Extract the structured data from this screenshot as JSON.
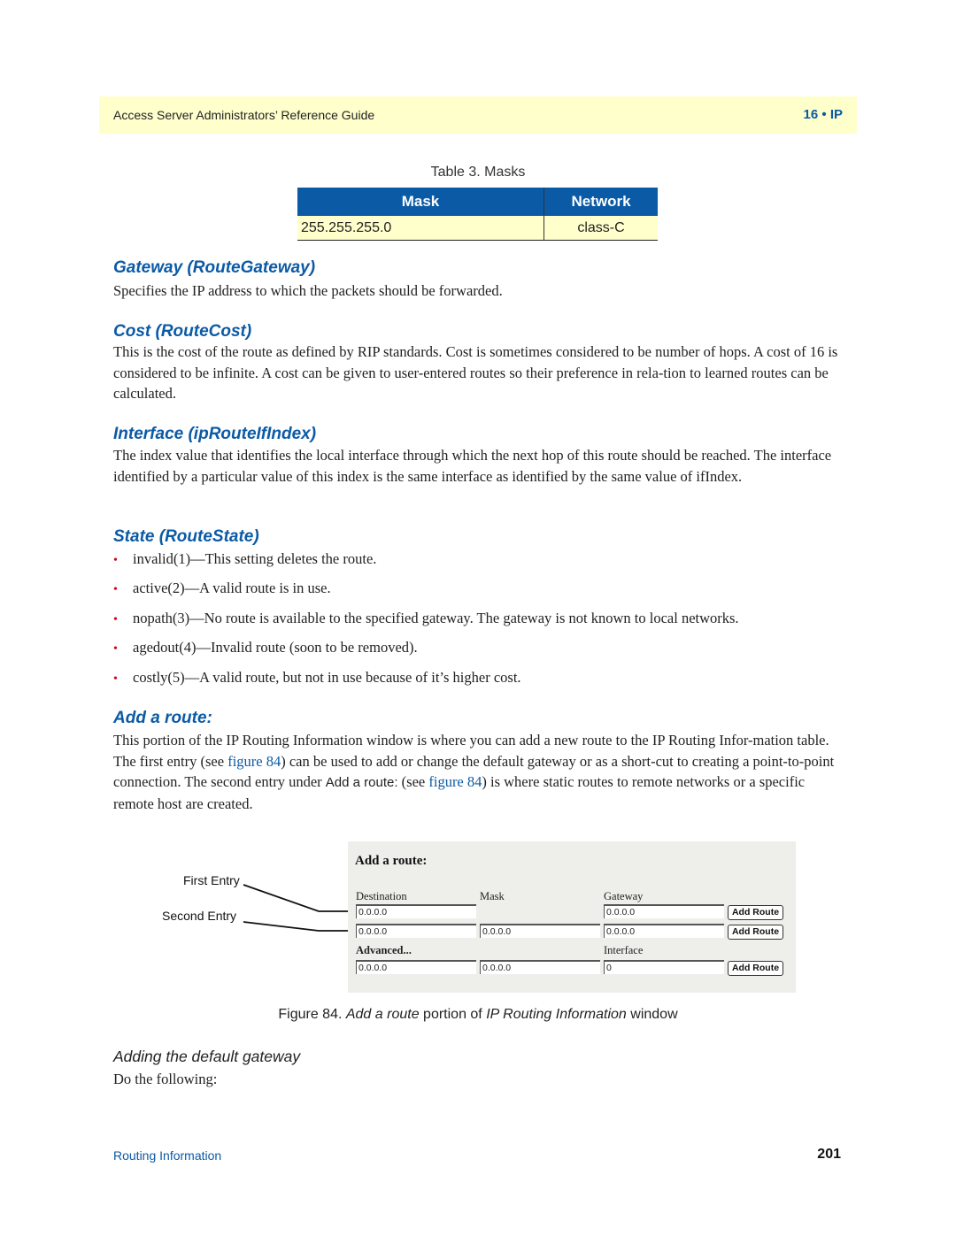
{
  "header": {
    "title": "Access Server Administrators’ Reference Guide",
    "chapter": "16 • IP"
  },
  "table": {
    "caption": "Table 3. Masks",
    "columns": [
      "Mask",
      "Network"
    ],
    "rows": [
      [
        "255.255.255.0",
        "class-C"
      ]
    ]
  },
  "sections": {
    "gateway": {
      "heading": "Gateway (RouteGateway)",
      "body": "Specifies the IP address to which the packets should be forwarded."
    },
    "cost": {
      "heading": "Cost (RouteCost)",
      "body": "This is the cost of the route as defined by RIP standards. Cost is sometimes considered to be number of hops. A cost of 16 is considered to be infinite. A cost can be given to user-entered routes so their preference in rela-tion to learned routes can be calculated."
    },
    "interface": {
      "heading": "Interface (ipRouteIfIndex)",
      "body": "The index value that identifies the local interface through which the next hop of this route should be reached. The interface identified by a particular value of this index is the same interface as identified by the same value of ifIndex."
    },
    "state": {
      "heading": "State (RouteState)",
      "bullets": [
        "invalid(1)—This setting deletes the route.",
        "active(2)—A valid route is in use.",
        "nopath(3)—No route is available to the specified gateway. The gateway is not known to local networks.",
        "agedout(4)—Invalid route (soon to be removed).",
        "costly(5)—A valid route, but not in use because of it’s higher cost."
      ]
    },
    "add_route": {
      "heading": "Add a route:",
      "body_1": "This portion of the IP Routing Information window is where you can add a new route to the IP Routing Infor-mation table. The first entry (see ",
      "link_1": "figure 84",
      "body_2": ") can be used to add or change the default gateway or as a short-cut to creating a point-to-point connection. The second entry under ",
      "inline_ui": "Add a route:",
      "body_3": " (see ",
      "link_2": "figure 84",
      "body_4": ") is where static routes to remote networks or a specific remote host are created."
    }
  },
  "figure": {
    "title": "Add a route:",
    "callouts": [
      "First Entry",
      "Second Entry"
    ],
    "labels": {
      "destination": "Destination",
      "mask": "Mask",
      "gateway": "Gateway",
      "advanced": "Advanced...",
      "interface": "Interface"
    },
    "row1": {
      "destination": "0.0.0.0",
      "gateway": "0.0.0.0",
      "button": "Add Route"
    },
    "row2": {
      "destination": "0.0.0.0",
      "mask": "0.0.0.0",
      "gateway": "0.0.0.0",
      "button": "Add Route"
    },
    "row3": {
      "destination": "0.0.0.0",
      "mask": "0.0.0.0",
      "interface": "0",
      "button": "Add Route"
    },
    "caption_prefix": "Figure 84. ",
    "caption_italic_1": "Add a route",
    "caption_mid": " portion of ",
    "caption_italic_2": "IP Routing Information",
    "caption_suffix": " window"
  },
  "subsection": {
    "heading": "Adding the default gateway",
    "body": "Do the following:"
  },
  "footer": {
    "section": "Routing Information",
    "page": "201"
  }
}
